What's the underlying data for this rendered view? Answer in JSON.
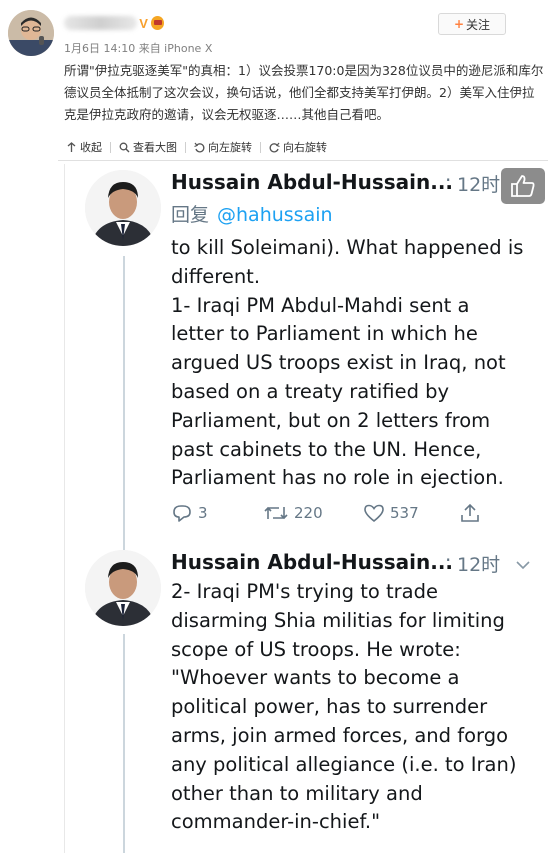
{
  "post": {
    "username_badge_v": "V",
    "follow_label": "关注",
    "meta": "1月6日 14:10 来自 iPhone X",
    "text": "所谓\"伊拉克驱逐美军\"的真相：1）议会投票170:0是因为328位议员中的逊尼派和库尔德议员全体抵制了这次会议，换句话说，他们全都支持美军打伊朗。2）美军入住伊拉克是伊拉克政府的邀请，议会无权驱逐……其他自己看吧。"
  },
  "toolbar": {
    "collapse": "收起",
    "view_large": "查看大图",
    "rotate_left": "向左旋转",
    "rotate_right": "向右旋转"
  },
  "tweets": [
    {
      "author": "Hussain Abdul-Hussain...",
      "time": "12时",
      "reply_label": "回复",
      "reply_handle": "@hahussain",
      "lines": [
        "to kill Soleimani). What happened is",
        "different.",
        "1- Iraqi PM Abdul-Mahdi sent a",
        "letter to Parliament in which he",
        "argued US troops exist in Iraq, not",
        "based on a treaty ratified by",
        "Parliament, but on 2 letters from",
        "past cabinets to the UN. Hence,",
        "Parliament has no role in ejection."
      ],
      "replies": "3",
      "retweets": "220",
      "likes": "537"
    },
    {
      "author": "Hussain Abdul-Hussain...",
      "time": "12时",
      "lines": [
        "2- Iraqi PM's trying to trade",
        "disarming Shia militias for limiting",
        "scope of US troops. He wrote:",
        "\"Whoever wants to become a",
        "political power, has to surrender",
        "arms, join armed forces, and forgo",
        "any political allegiance (i.e. to Iran)",
        "other than to military and",
        "commander-in-chief.\""
      ]
    }
  ],
  "colors": {
    "link_blue": "#1da1f2",
    "tweet_gray": "#657786",
    "follow_plus": "#ff8140",
    "vip_badge": "#f7a02e"
  },
  "icons": [
    "collapse-icon",
    "search-icon",
    "rotate-left-icon",
    "rotate-right-icon",
    "reply-icon",
    "retweet-icon",
    "like-icon",
    "share-icon",
    "chevron-down-icon",
    "thumbs-up-icon"
  ]
}
